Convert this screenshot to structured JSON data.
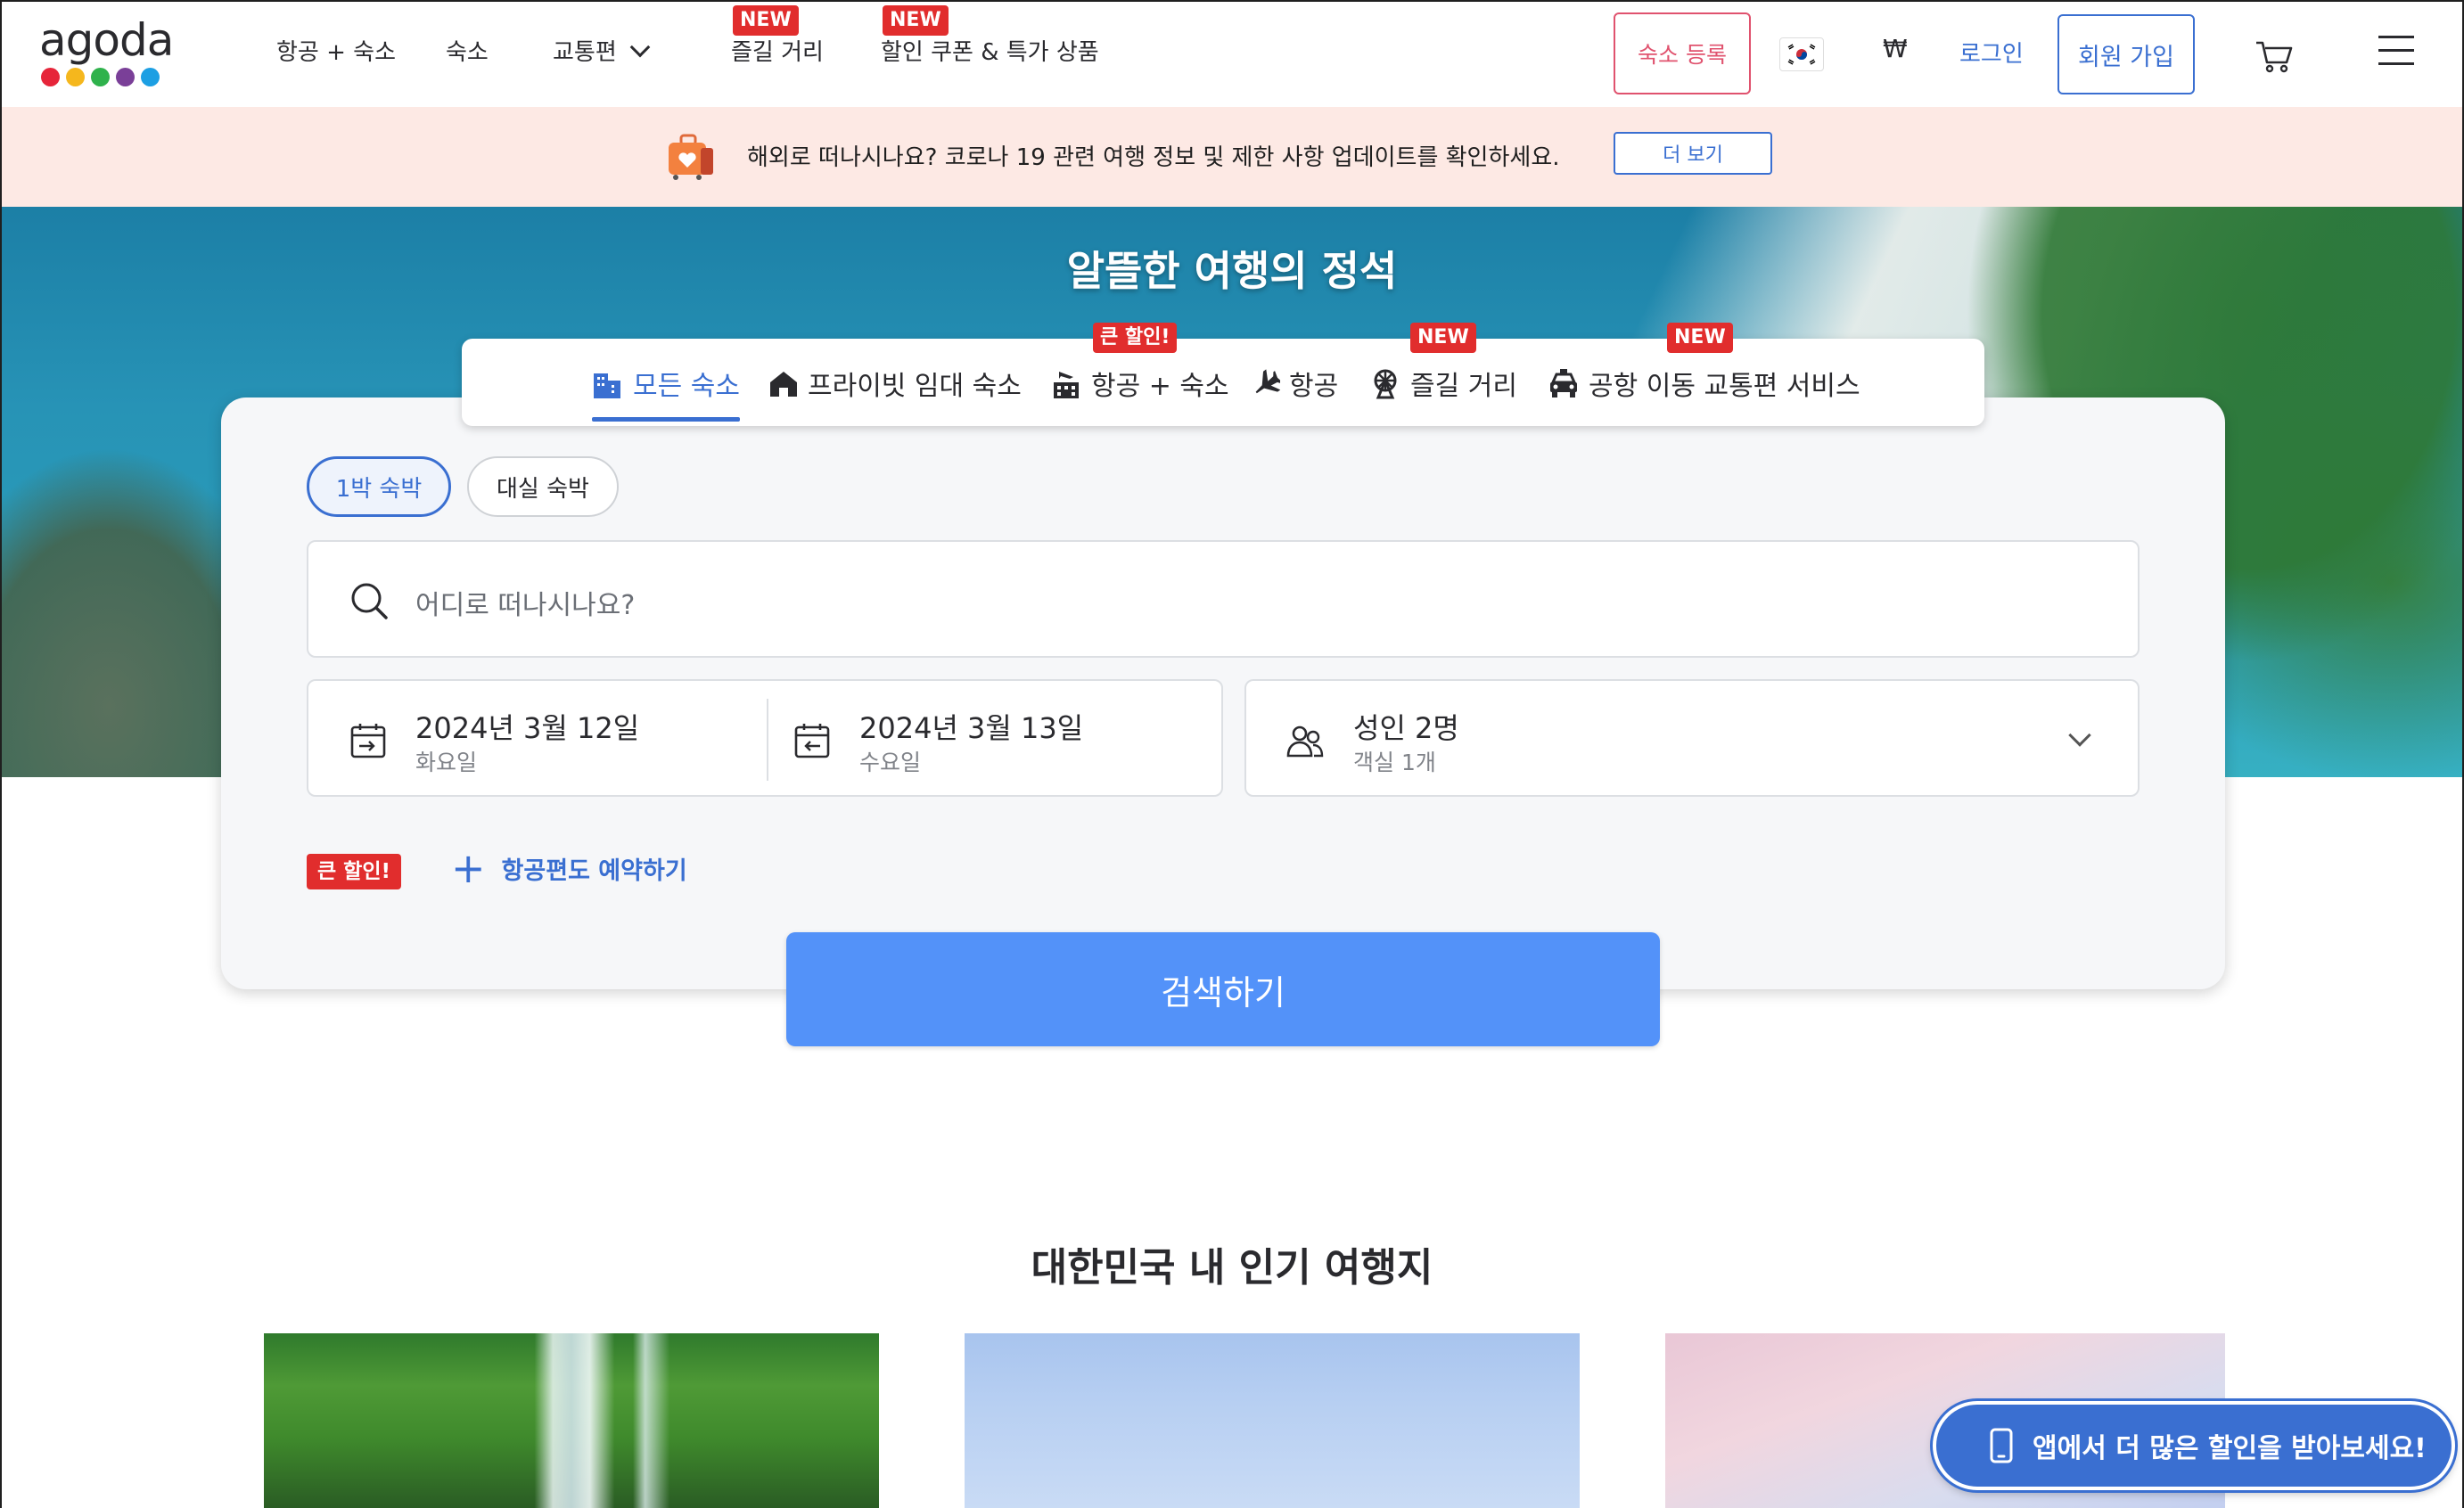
{
  "brand": {
    "name": "agoda",
    "dot_colors": [
      "#e6253a",
      "#f5b71d",
      "#2fb24c",
      "#7a3f98",
      "#1c9fe3"
    ]
  },
  "nav": {
    "items": [
      {
        "label": "항공 + 숙소",
        "badge": ""
      },
      {
        "label": "숙소",
        "badge": ""
      },
      {
        "label": "교통편",
        "badge": ""
      },
      {
        "label": "즐길 거리",
        "badge": "NEW"
      },
      {
        "label": "할인 쿠폰 & 특가 상품",
        "badge": "NEW"
      }
    ],
    "register_label": "숙소 등록",
    "currency": "₩",
    "login_label": "로그인",
    "signup_label": "회원 가입",
    "flag_icon": "korea-flag-icon",
    "cart_icon": "cart-icon",
    "menu_icon": "hamburger-menu-icon"
  },
  "notice": {
    "text": "해외로 떠나시나요? 코로나 19 관련 여행 정보 및 제한 사항 업데이트를 확인하세요.",
    "button_label": "더 보기"
  },
  "hero": {
    "title": "알뜰한 여행의 정석"
  },
  "tabs": [
    {
      "label": "모든 숙소",
      "icon": "buildings-icon",
      "active": true,
      "badge": ""
    },
    {
      "label": "프라이빗 임대 숙소",
      "icon": "house-icon",
      "active": false,
      "badge": ""
    },
    {
      "label": "항공 + 숙소",
      "icon": "flight-hotel-icon",
      "active": false,
      "badge": "큰 할인!"
    },
    {
      "label": "항공",
      "icon": "plane-icon",
      "active": false,
      "badge": ""
    },
    {
      "label": "즐길 거리",
      "icon": "ferris-wheel-icon",
      "active": false,
      "badge": "NEW"
    },
    {
      "label": "공항 이동 교통편 서비스",
      "icon": "car-icon",
      "active": false,
      "badge": "NEW"
    }
  ],
  "stay_type": {
    "options": [
      "1박 숙박",
      "대실 숙박"
    ],
    "selected": "1박 숙박"
  },
  "search": {
    "placeholder": "어디로 떠나시나요?"
  },
  "dates": {
    "checkin": {
      "date": "2024년 3월 12일",
      "day": "화요일"
    },
    "checkout": {
      "date": "2024년 3월 13일",
      "day": "수요일"
    }
  },
  "guests": {
    "main": "성인 2명",
    "sub": "객실 1개"
  },
  "add_flight": {
    "badge": "큰 할인!",
    "label": "항공편도 예약하기"
  },
  "search_button_label": "검색하기",
  "popular": {
    "title": "대한민국 내 인기 여행지",
    "cards": [
      "waterfall-image",
      "sky-image",
      "pink-sky-image"
    ]
  },
  "app_promo": {
    "label": "앱에서 더 많은 할인을 받아보세요!"
  },
  "colors": {
    "accent": "#3a6fd1",
    "search_button": "#5392f9",
    "badge_red": "#e12d2d",
    "register_pink": "#e0526e",
    "notice_bg": "#fde9e4"
  }
}
